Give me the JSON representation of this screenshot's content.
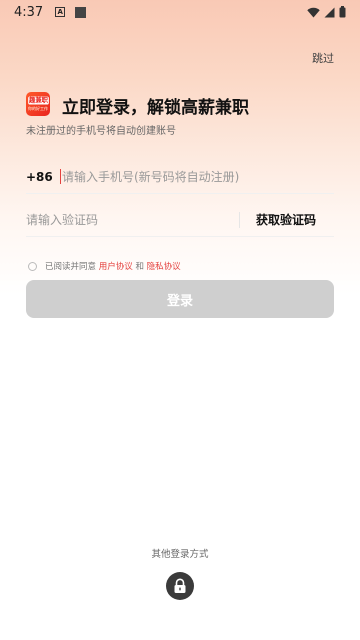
{
  "status_bar": {
    "time": "4:37",
    "notif_a": "A"
  },
  "header": {
    "skip_label": "跳过"
  },
  "logo": {
    "text": "趣兼职",
    "sub": "你的好工作"
  },
  "title": "立即登录，解锁高薪兼职",
  "subtitle": "未注册过的手机号将自动创建账号",
  "phone": {
    "country_code": "+86",
    "placeholder": "请输入手机号(新号码将自动注册)",
    "value": ""
  },
  "code": {
    "placeholder": "请输入验证码",
    "value": "",
    "get_code_label": "获取验证码"
  },
  "agreement": {
    "prefix": "已阅读并同意",
    "user_agreement": "用户协议",
    "and": "和",
    "privacy": "隐私协议"
  },
  "login_button": "登录",
  "other_login_label": "其他登录方式",
  "colors": {
    "accent": "#e4423f",
    "button_disabled": "#cfcfcf"
  }
}
